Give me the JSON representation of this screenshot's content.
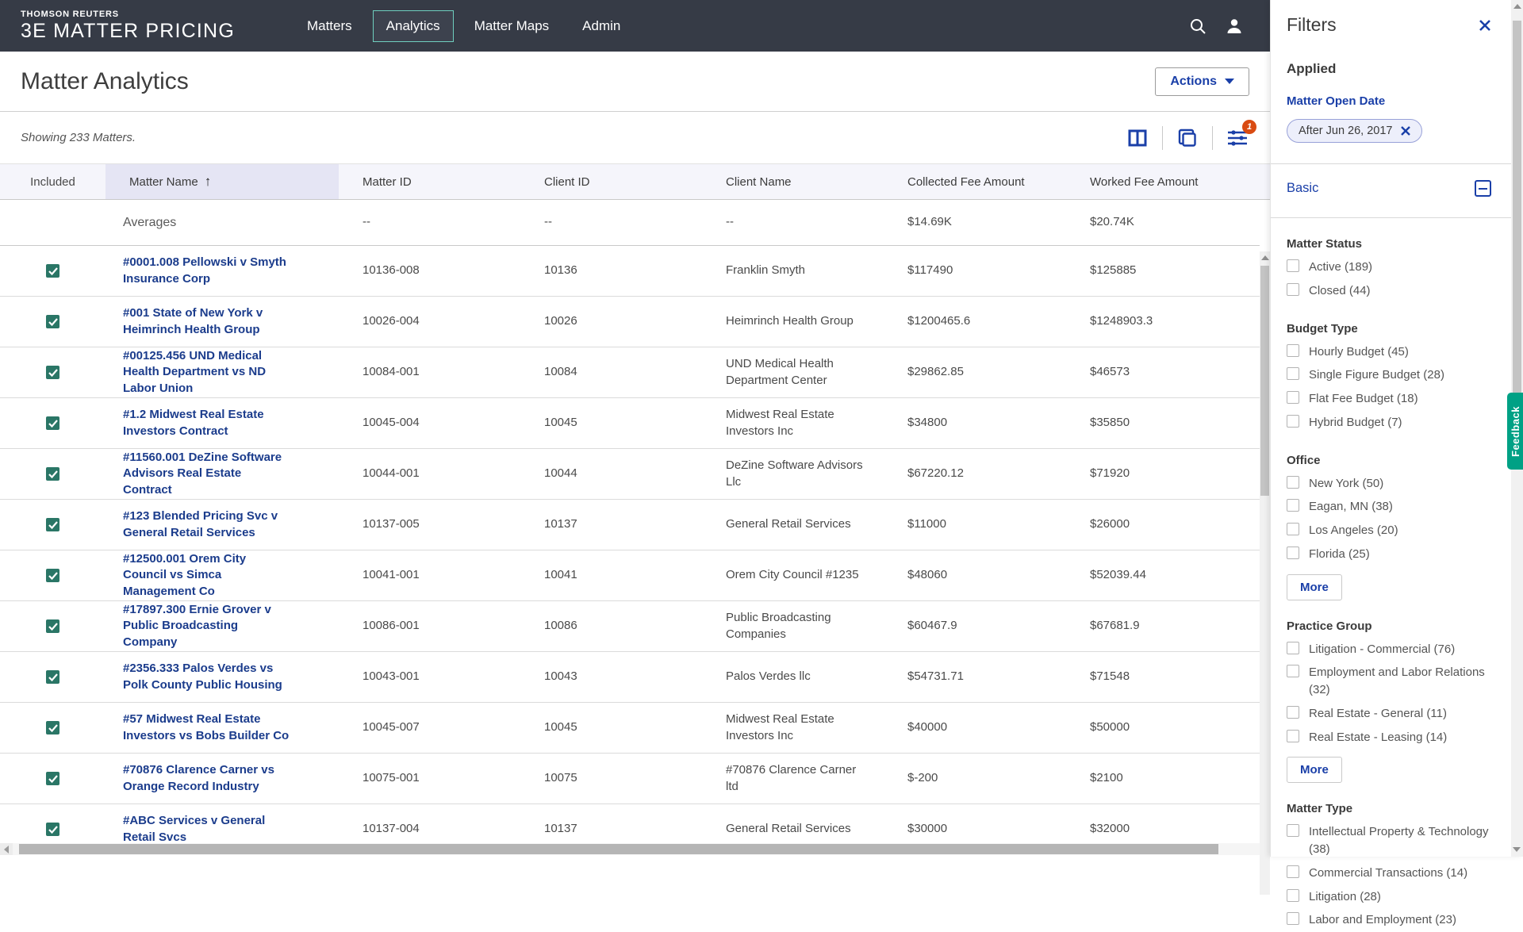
{
  "nav": {
    "brand_line1": "THOMSON REUTERS",
    "brand_line2": "3E MATTER PRICING",
    "items": [
      {
        "label": "Matters"
      },
      {
        "label": "Analytics"
      },
      {
        "label": "Matter Maps"
      },
      {
        "label": "Admin"
      }
    ]
  },
  "page": {
    "title": "Matter Analytics",
    "actions_label": "Actions",
    "status": "Showing 233 Matters.",
    "filter_badge_count": "1"
  },
  "icons": {
    "sort_asc": "↑"
  },
  "colors": {
    "nav_bg": "#363B46",
    "accent_teal": "#6FCFBF",
    "link_blue": "#1B3C8C",
    "action_blue": "#1A3FA8",
    "checkbox_green": "#2A7666",
    "badge_orange": "#D94B12",
    "feedback_green": "#00A185",
    "sorted_column_bg": "#E5E5F4"
  },
  "table": {
    "columns": [
      "Included",
      "Matter Name",
      "Matter ID",
      "Client ID",
      "Client Name",
      "Collected Fee Amount",
      "Worked Fee Amount"
    ],
    "averages": {
      "label": "Averages",
      "matter_id": "--",
      "client_id": "--",
      "client_name": "--",
      "collected": "$14.69K",
      "worked": "$20.74K"
    },
    "rows": [
      {
        "name": "#0001.008 Pellowski v Smyth Insurance Corp",
        "matter_id": "10136-008",
        "client_id": "10136",
        "client_name": "Franklin Smyth",
        "collected": "$117490",
        "worked": "$125885"
      },
      {
        "name": "#001 State of New York v Heimrinch Health Group",
        "matter_id": "10026-004",
        "client_id": "10026",
        "client_name": "Heimrinch Health Group",
        "collected": "$1200465.6",
        "worked": "$1248903.3"
      },
      {
        "name": "#00125.456 UND Medical Health Department vs ND Labor Union",
        "matter_id": "10084-001",
        "client_id": "10084",
        "client_name": "UND Medical Health Department Center",
        "collected": "$29862.85",
        "worked": "$46573"
      },
      {
        "name": "#1.2 Midwest Real Estate Investors Contract",
        "matter_id": "10045-004",
        "client_id": "10045",
        "client_name": "Midwest Real Estate Investors Inc",
        "collected": "$34800",
        "worked": "$35850"
      },
      {
        "name": "#11560.001 DeZine Software Advisors Real Estate Contract",
        "matter_id": "10044-001",
        "client_id": "10044",
        "client_name": "DeZine Software Advisors Llc",
        "collected": "$67220.12",
        "worked": "$71920"
      },
      {
        "name": "#123 Blended Pricing Svc v General Retail Services",
        "matter_id": "10137-005",
        "client_id": "10137",
        "client_name": "General Retail Services",
        "collected": "$11000",
        "worked": "$26000"
      },
      {
        "name": "#12500.001 Orem City Council vs Simca Management Co",
        "matter_id": "10041-001",
        "client_id": "10041",
        "client_name": "Orem City Council #1235",
        "collected": "$48060",
        "worked": "$52039.44"
      },
      {
        "name": "#17897.300 Ernie Grover v Public Broadcasting Company",
        "matter_id": "10086-001",
        "client_id": "10086",
        "client_name": "Public Broadcasting Companies",
        "collected": "$60467.9",
        "worked": "$67681.9"
      },
      {
        "name": "#2356.333 Palos Verdes vs Polk County Public Housing",
        "matter_id": "10043-001",
        "client_id": "10043",
        "client_name": "Palos Verdes llc",
        "collected": "$54731.71",
        "worked": "$71548"
      },
      {
        "name": "#57 Midwest Real Estate Investors vs Bobs Builder Co",
        "matter_id": "10045-007",
        "client_id": "10045",
        "client_name": "Midwest Real Estate Investors Inc",
        "collected": "$40000",
        "worked": "$50000"
      },
      {
        "name": "#70876 Clarence Carner vs Orange Record Industry",
        "matter_id": "10075-001",
        "client_id": "10075",
        "client_name": "#70876 Clarence Carner ltd",
        "collected": "$-200",
        "worked": "$2100"
      },
      {
        "name": "#ABC Services v General Retail Svcs",
        "matter_id": "10137-004",
        "client_id": "10137",
        "client_name": "General Retail Services",
        "collected": "$30000",
        "worked": "$32000"
      }
    ]
  },
  "filters": {
    "title": "Filters",
    "applied_heading": "Applied",
    "applied_filter_name": "Matter Open Date",
    "applied_chip": "After Jun 26, 2017",
    "section_label": "Basic",
    "more_label": "More",
    "feedback_label": "Feedback",
    "groups": [
      {
        "heading": "Matter Status",
        "options": [
          "Active (189)",
          "Closed (44)"
        ]
      },
      {
        "heading": "Budget Type",
        "options": [
          "Hourly Budget (45)",
          "Single Figure Budget (28)",
          "Flat Fee Budget (18)",
          "Hybrid Budget (7)"
        ]
      },
      {
        "heading": "Office",
        "options": [
          "New York (50)",
          "Eagan, MN (38)",
          "Los Angeles (20)",
          "Florida (25)"
        ]
      },
      {
        "heading": "Practice Group",
        "options": [
          "Litigation - Commercial (76)",
          "Employment and Labor Relations (32)",
          "Real Estate - General (11)",
          "Real Estate - Leasing (14)"
        ]
      },
      {
        "heading": "Matter Type",
        "options": [
          "Intellectual Property & Technology (38)",
          "Commercial Transactions (14)",
          "Litigation (28)",
          "Labor and Employment (23)"
        ]
      }
    ]
  }
}
